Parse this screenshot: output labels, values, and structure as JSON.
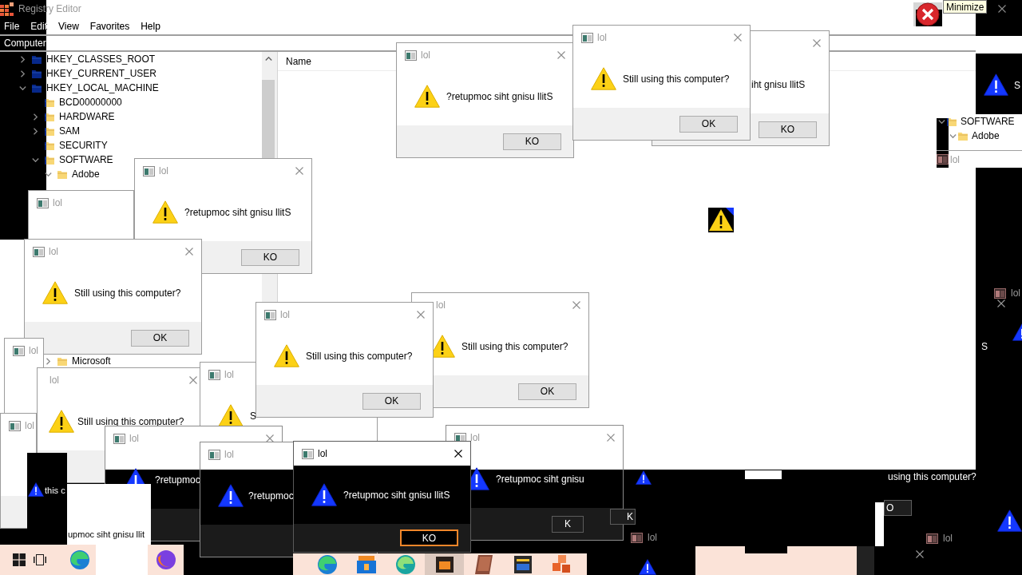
{
  "registry_editor": {
    "title": "Registry Editor",
    "tooltip": "Minimize",
    "menu": [
      "File",
      "Edit",
      "View",
      "Favorites",
      "Help"
    ],
    "address": "Computer",
    "tree": [
      {
        "label": "HKEY_CLASSES_ROOT",
        "expanded": false
      },
      {
        "label": "HKEY_CURRENT_USER",
        "expanded": false
      },
      {
        "label": "HKEY_LOCAL_MACHINE",
        "expanded": true,
        "children": [
          {
            "label": "BCD00000000"
          },
          {
            "label": "HARDWARE",
            "expanded": false
          },
          {
            "label": "SAM",
            "expanded": false
          },
          {
            "label": "SECURITY"
          },
          {
            "label": "SOFTWARE",
            "expanded": true,
            "children": [
              {
                "label": "Adobe",
                "expanded": true
              },
              {
                "label": "Microsoft",
                "expanded": false
              }
            ]
          }
        ]
      }
    ],
    "columns": [
      "Name"
    ]
  },
  "side_tree": {
    "items": [
      {
        "label": "SOFTWARE",
        "expanded": true,
        "children": [
          {
            "label": "Adobe",
            "expanded": true
          }
        ]
      }
    ],
    "window_title": "lol"
  },
  "message_boxes": [
    {
      "kind": "light",
      "active": false,
      "title": "lol"
    },
    {
      "kind": "light",
      "active": false,
      "title": "lol",
      "message": "?retupmoc siht gnisu llitS",
      "button": "KO",
      "button_focused": false
    },
    {
      "kind": "light",
      "active": false,
      "title": "lol",
      "message": "Still using this computer?",
      "button": "OK",
      "button_focused": false
    },
    {
      "kind": "light",
      "active": false,
      "title": "lol"
    },
    {
      "kind": "light",
      "active": false,
      "title": "lol"
    },
    {
      "kind": "light",
      "active": false,
      "title": "lol",
      "message": "Still using this computer?"
    },
    {
      "kind": "light",
      "active": false,
      "title": "lol",
      "message": "S"
    },
    {
      "kind": "light",
      "active": false,
      "title": "lol",
      "message": "Still using this computer?",
      "button": "OK",
      "button_focused": false
    },
    {
      "kind": "light",
      "active": false,
      "title": "lol",
      "message": "Still using this computer?",
      "button": "OK",
      "button_focused": false
    },
    {
      "kind": "mixed",
      "active": false,
      "title": "lol",
      "message": "?retupmoc"
    },
    {
      "kind": "mixed",
      "active": false,
      "title": "lol",
      "message": "?retupmoc"
    },
    {
      "kind": "mixed",
      "active": false,
      "title": "lol",
      "message": "?retupmoc siht gnisu",
      "button": "K",
      "button_focused": false
    },
    {
      "kind": "dark",
      "active": true,
      "title": "lol",
      "message": "?retupmoc siht gnisu llitS",
      "button": "KO",
      "button_focused": true
    },
    {
      "kind": "light",
      "active": false,
      "title": "lol",
      "message": "?retupmoc siht gnisu llitS",
      "button": "KO",
      "button_focused": false
    },
    {
      "kind": "light",
      "active": false,
      "message": "iht gnisu llitS",
      "button": "KO",
      "button_focused": false
    },
    {
      "kind": "light",
      "active": false,
      "title": "lol",
      "message": "Still using this computer?",
      "button": "OK",
      "button_focused": false
    }
  ],
  "glitch_fragments": [
    {
      "kind": "text",
      "text": "S"
    },
    {
      "kind": "title",
      "text": "lol"
    },
    {
      "kind": "text",
      "text": "S"
    },
    {
      "kind": "text",
      "text": "using this computer?"
    },
    {
      "kind": "text",
      "text": "this c"
    },
    {
      "kind": "panel",
      "text": "upmoc siht gnisu llit"
    },
    {
      "kind": "button",
      "text": "K"
    },
    {
      "kind": "button",
      "text": "O"
    },
    {
      "kind": "title",
      "text": "lol"
    },
    {
      "kind": "title",
      "text": "lol"
    }
  ]
}
